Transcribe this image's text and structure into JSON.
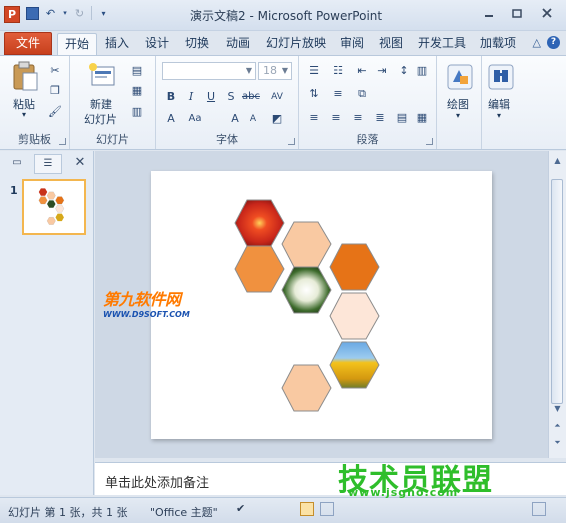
{
  "window": {
    "title": "演示文稿2 - Microsoft PowerPoint",
    "app_icon_letter": "P"
  },
  "qat": {
    "undo_icon": "undo-icon",
    "redo_icon": "redo-icon",
    "customize_icon": "chevron-down-icon"
  },
  "tabs": {
    "file": "文件",
    "items": [
      "开始",
      "插入",
      "设计",
      "切换",
      "动画",
      "幻灯片放映",
      "审阅",
      "视图",
      "开发工具",
      "加载项"
    ],
    "active": "开始"
  },
  "ribbon": {
    "clipboard": {
      "label": "剪贴板",
      "paste": "粘贴"
    },
    "slides": {
      "label": "幻灯片",
      "new_slide_line1": "新建",
      "new_slide_line2": "幻灯片"
    },
    "font": {
      "label": "字体",
      "font_name": "",
      "font_size": "18"
    },
    "paragraph": {
      "label": "段落"
    },
    "drawing": {
      "label": "绘图"
    },
    "editing": {
      "label": "编辑"
    }
  },
  "left_pane": {
    "slide_number": "1"
  },
  "slide": {
    "watermark_main": "第九软件网",
    "watermark_sub": "WWW.D9SOFT.COM",
    "hexagon_colors": {
      "light_peach": "#f9c9a2",
      "orange": "#f0913f",
      "dark_orange": "#e67317",
      "pale_peach": "#fde6d8",
      "outline": "#8c8c8c"
    }
  },
  "notes": {
    "placeholder": "单击此处添加备注"
  },
  "watermark_bottom": {
    "main": "技术员联盟",
    "sub": "www.jsgho.com"
  },
  "status": {
    "slide_info": "幻灯片 第 1 张，共 1 张",
    "theme": "\"Office 主题\""
  }
}
